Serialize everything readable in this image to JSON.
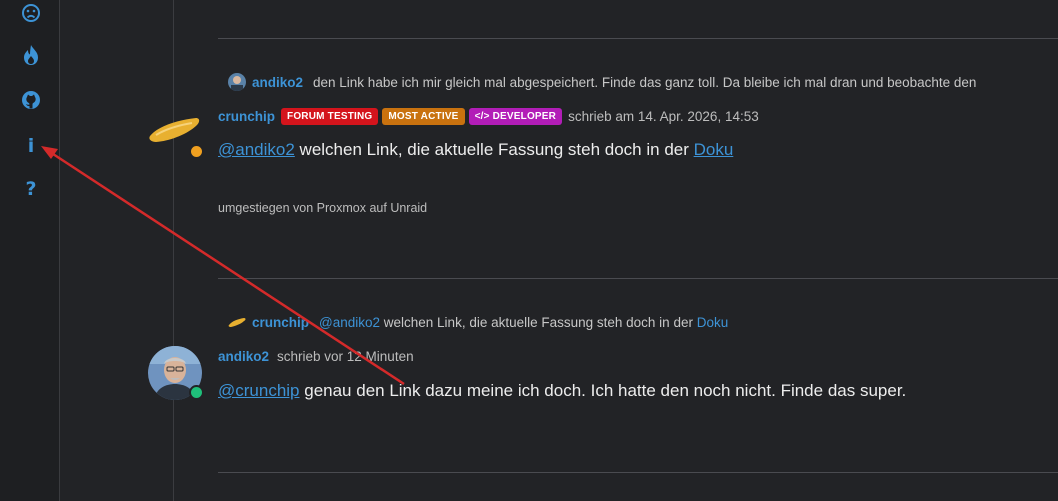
{
  "sidebar": {
    "icons": [
      {
        "name": "frown-icon"
      },
      {
        "name": "fire-icon"
      },
      {
        "name": "github-icon"
      },
      {
        "name": "info-icon",
        "glyph": "i"
      },
      {
        "name": "help-icon",
        "glyph": "?"
      }
    ]
  },
  "post1_reply": {
    "author": "andiko2",
    "text": "den Link habe ich mir gleich mal abgespeichert. Finde das ganz toll. Da bleibe ich mal dran und beobachte den"
  },
  "post1": {
    "author": "crunchip",
    "badges": [
      "FORUM TESTING",
      "MOST ACTIVE",
      "DEVELOPER"
    ],
    "developer_glyph": "</>",
    "meta": "schrieb am 14. Apr. 2026, 14:53",
    "mention": "@andiko2",
    "body": " welchen Link, die aktuelle Fassung steh doch in der ",
    "link": "Doku",
    "signature": "umgestiegen von Proxmox auf Unraid",
    "status": "away"
  },
  "post2_reply": {
    "author": "crunchip",
    "mention": "@andiko2",
    "text": " welchen Link, die aktuelle Fassung steh doch in der ",
    "link": "Doku"
  },
  "post2": {
    "author": "andiko2",
    "meta": "schrieb vor 12 Minuten",
    "mention": "@crunchip",
    "body": " genau den Link dazu meine ich doch. Ich hatte den noch nicht. Finde das super.",
    "status": "online"
  },
  "colors": {
    "accent": "#3d93d6",
    "badge_forum_testing": "#d4141c",
    "badge_most_active": "#c9720f",
    "badge_developer": "#b21db7",
    "status_away": "#f0a020",
    "status_online": "#1fbf7a",
    "annotation_arrow": "#d42a2a"
  }
}
